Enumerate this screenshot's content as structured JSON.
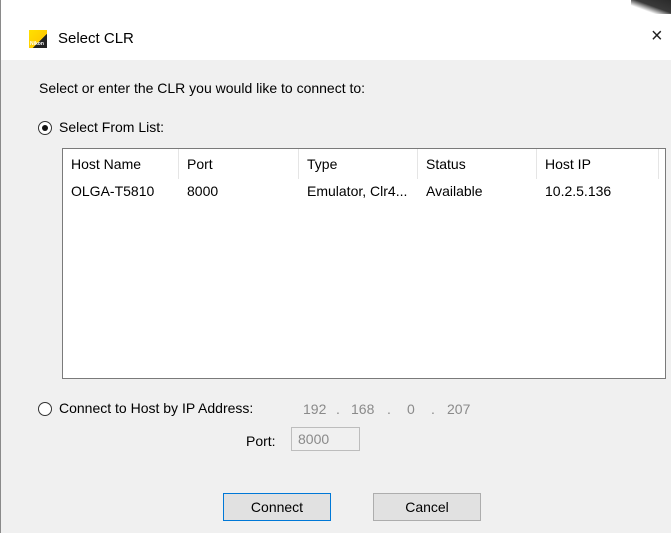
{
  "window": {
    "title": "Select CLR",
    "icon": "nikon-app-icon",
    "icon_text": "Nikon",
    "close_glyph": "×"
  },
  "prompt": "Select or enter the CLR you would like to connect to:",
  "select_from_list": {
    "label": "Select From List:",
    "checked": true
  },
  "list": {
    "columns": [
      "Host Name",
      "Port",
      "Type",
      "Status",
      "Host IP"
    ],
    "rows": [
      [
        "OLGA-T5810",
        "8000",
        "Emulator, Clr4...",
        "Available",
        "10.2.5.136"
      ]
    ]
  },
  "connect_by_ip": {
    "label": "Connect to Host by IP Address:",
    "checked": false,
    "ip": [
      "192",
      "168",
      "0",
      "207"
    ],
    "port_label": "Port:",
    "port_value": "8000"
  },
  "buttons": {
    "connect": "Connect",
    "cancel": "Cancel"
  },
  "colors": {
    "client_bg": "#f0f0f0",
    "default_button_border": "#0078d7",
    "disabled_text": "#8a8a8a"
  }
}
